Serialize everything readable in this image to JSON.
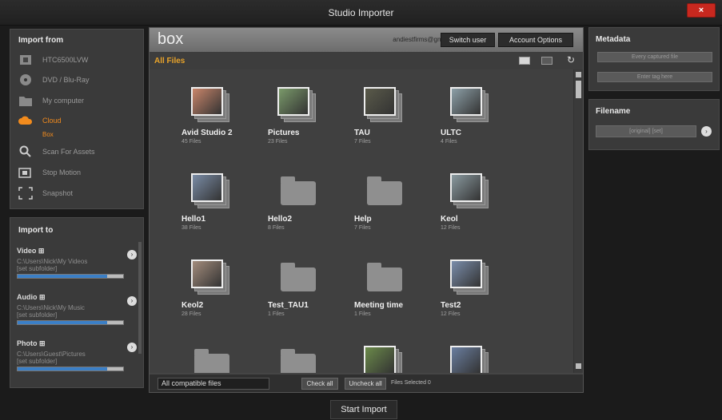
{
  "window": {
    "title": "Studio Importer",
    "close_label": "×"
  },
  "import_from": {
    "title": "Import from",
    "items": [
      {
        "label": "HTC6500LVW",
        "icon": "phone-icon"
      },
      {
        "label": "DVD / Blu-Ray",
        "icon": "disc-icon"
      },
      {
        "label": "My computer",
        "icon": "folder-icon"
      },
      {
        "label": "Cloud",
        "icon": "cloud-icon",
        "sub": "Box"
      },
      {
        "label": "Scan For Assets",
        "icon": "magnifier-icon"
      },
      {
        "label": "Stop Motion",
        "icon": "camera-icon"
      },
      {
        "label": "Snapshot",
        "icon": "snapshot-icon"
      }
    ]
  },
  "import_to": {
    "title": "Import to",
    "destinations": [
      {
        "label": "Video ⊞",
        "path": "C:\\Users\\Nick\\My Videos",
        "sub": "[set subfolder]",
        "fill": 0.85
      },
      {
        "label": "Audio ⊞",
        "path": "C:\\Users\\Nick\\My Music",
        "sub": "[set subfolder]",
        "fill": 0.85
      },
      {
        "label": "Photo ⊞",
        "path": "C:\\Users\\Guest\\Pictures",
        "sub": "[set subfolder]",
        "fill": 0.85
      }
    ]
  },
  "browser": {
    "logo": "box",
    "account_email": "andiestfirms@gmail.com",
    "switch_user": "Switch user",
    "account_options": "Account Options",
    "folder_title": "All Files",
    "items": [
      {
        "name": "Avid Studio 2",
        "count": "45 Files",
        "kind": "photo",
        "color": "#c9856a"
      },
      {
        "name": "Pictures",
        "count": "23 Files",
        "kind": "photo",
        "color": "#7a9a6a"
      },
      {
        "name": "TAU",
        "count": "7 Files",
        "kind": "photo",
        "color": "#5a5a4a"
      },
      {
        "name": "ULTC",
        "count": "4 Files",
        "kind": "photo",
        "color": "#8da0a8"
      },
      {
        "name": "Hello1",
        "count": "38 Files",
        "kind": "photo",
        "color": "#7a8ca6"
      },
      {
        "name": "Hello2",
        "count": "8 Files",
        "kind": "folder"
      },
      {
        "name": "Help",
        "count": "7 Files",
        "kind": "folder"
      },
      {
        "name": "Keol",
        "count": "12 Files",
        "kind": "photo",
        "color": "#8a9aa0"
      },
      {
        "name": "Keol2",
        "count": "28 Files",
        "kind": "photo",
        "color": "#a38c7c"
      },
      {
        "name": "Test_TAU1",
        "count": "1 Files",
        "kind": "folder"
      },
      {
        "name": "Meeting time",
        "count": "1 Files",
        "kind": "folder"
      },
      {
        "name": "Test2",
        "count": "12 Files",
        "kind": "photo",
        "color": "#7a8dab"
      },
      {
        "name": "",
        "count": "",
        "kind": "folder"
      },
      {
        "name": "",
        "count": "",
        "kind": "folder"
      },
      {
        "name": "",
        "count": "",
        "kind": "photo",
        "color": "#6b8a4a"
      },
      {
        "name": "",
        "count": "",
        "kind": "photo",
        "color": "#6a7ea0"
      }
    ],
    "filter": "All compatible files",
    "check_all": "Check all",
    "uncheck_all": "Uncheck all",
    "selected_text": "Files Selected 0"
  },
  "start_import": "Start Import",
  "metadata": {
    "title": "Metadata",
    "button1": "Every captured file",
    "button2": "Enter tag here"
  },
  "filename": {
    "title": "Filename",
    "value": "[original] [set]"
  },
  "colors": {
    "accent": "#f28b1d",
    "folder_title": "#e8a32a",
    "close": "#c8281f",
    "progress": "#3b7fc6"
  }
}
